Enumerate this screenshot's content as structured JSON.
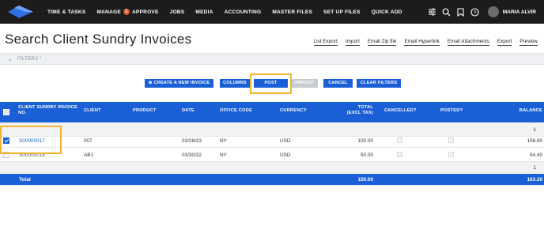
{
  "nav": {
    "items": [
      {
        "label": "TIME & TASKS",
        "badge": ""
      },
      {
        "label": "MANAGE",
        "badge": "1"
      },
      {
        "label": "APPROVE",
        "badge": ""
      },
      {
        "label": "JOBS",
        "badge": ""
      },
      {
        "label": "MEDIA",
        "badge": ""
      },
      {
        "label": "ACCOUNTING",
        "badge": ""
      },
      {
        "label": "MASTER FILES",
        "badge": ""
      },
      {
        "label": "SET UP FILES",
        "badge": ""
      },
      {
        "label": "QUICK ADD",
        "badge": ""
      }
    ],
    "icons": [
      "sliders-icon",
      "search-icon",
      "bookmark-icon",
      "help-icon"
    ],
    "user_name": "MARIA ALVIR"
  },
  "page": {
    "title": "Search Client Sundry Invoices",
    "actions": [
      "List Export",
      "Import",
      "Email Zip file",
      "Email Hyperlink",
      "Email Attachments",
      "Export",
      "Preview"
    ]
  },
  "filters": {
    "label": "FILTERS *"
  },
  "toolbar": {
    "create": "CREATE A NEW INVOICE",
    "columns": "COLUMNS",
    "post": "POST",
    "unpost": "UNPOST",
    "cancel": "CANCEL",
    "clear": "CLEAR FILTERS"
  },
  "table": {
    "headers": {
      "invoice_no_1": "CLIENT SUNDRY INVOICE",
      "invoice_no_2": "NO.",
      "client": "CLIENT",
      "product": "PRODUCT",
      "date": "DATE",
      "office": "OFFICE CODE",
      "currency": "CURRENCY",
      "total_1": "TOTAL",
      "total_2": "(EXCL TAX)",
      "cancelled": "CANCELLED?",
      "posted": "POSTED?",
      "balance": "BALANCE"
    },
    "group_top": {
      "balance": "1"
    },
    "rows": [
      {
        "invoice_no": "S00000017",
        "client": "007",
        "product": "",
        "date": "03/28/23",
        "office": "NY",
        "currency": "USD",
        "total": "100.00",
        "balance": "108.80",
        "selected": true
      },
      {
        "invoice_no": "S00000018",
        "client": "AB1",
        "product": "",
        "date": "03/30/32",
        "office": "NY",
        "currency": "USD",
        "total": "50.00",
        "balance": "54.40",
        "selected": false
      }
    ],
    "group_bottom": {
      "balance": "1"
    },
    "total_row": {
      "label": "Total",
      "total": "150.00",
      "balance": "163.20"
    }
  },
  "colors": {
    "accent": "#1a5fd6",
    "nav_bg": "#1c1c1c",
    "highlight": "#f3b330",
    "badge": "#e0522a"
  }
}
